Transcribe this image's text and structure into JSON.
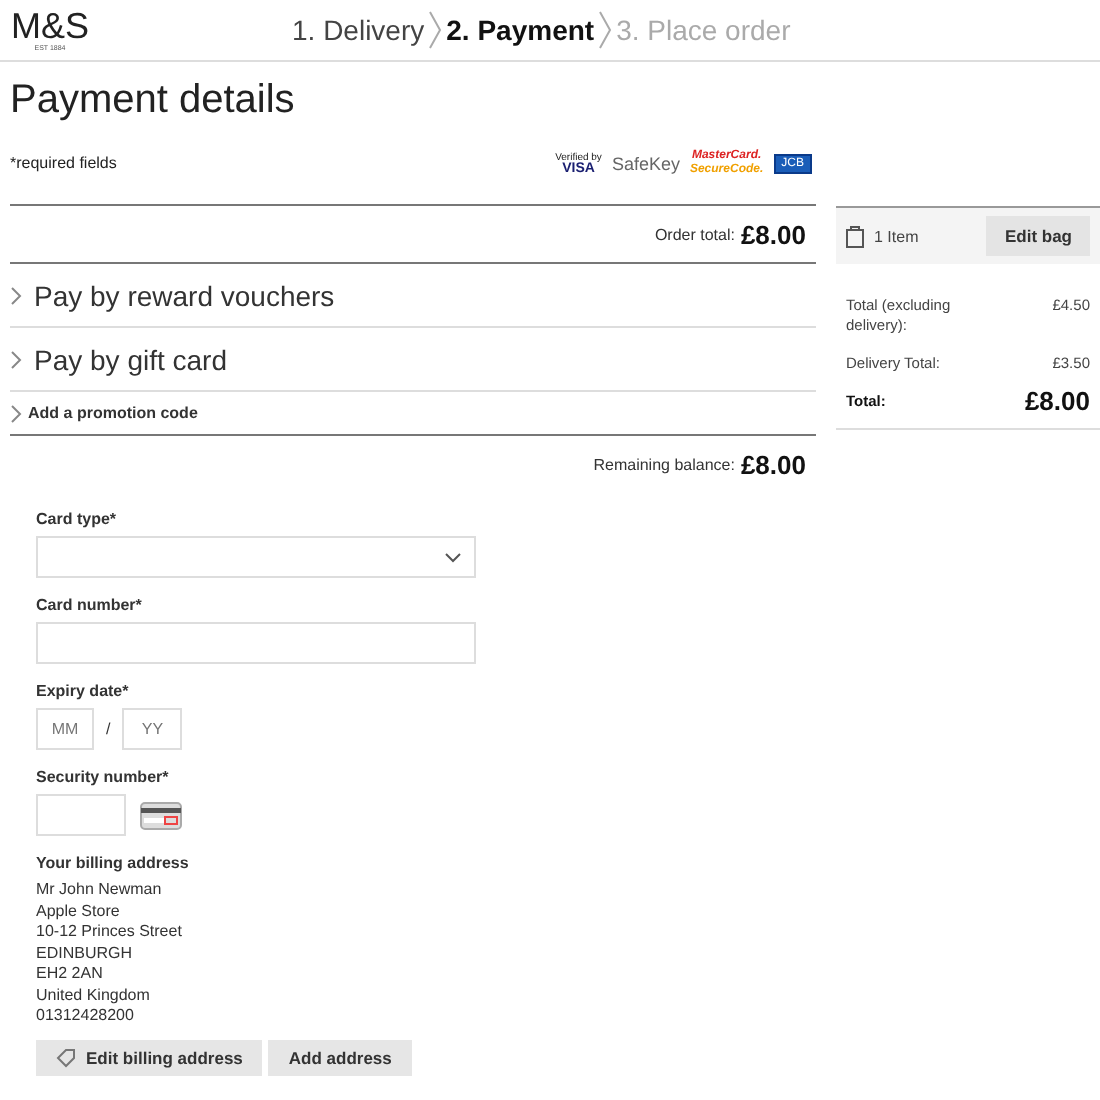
{
  "header": {
    "logo": "M&S",
    "logo_tagline": "EST 1884",
    "steps": [
      {
        "label": "1. Delivery",
        "selected": false
      },
      {
        "label": "2. Payment",
        "selected": true
      },
      {
        "label": "3. Place order",
        "selected": false
      }
    ]
  },
  "title": "Payment details",
  "required_note": "*required fields",
  "security_badges": [
    {
      "kind": "visa",
      "lines": [
        "Verified by",
        "VISA"
      ]
    },
    {
      "kind": "amex",
      "lines": [
        "SafeKey"
      ]
    },
    {
      "kind": "mastercard",
      "lines": [
        "MasterCard.",
        "SecureCode."
      ]
    },
    {
      "kind": "jcb",
      "lines": [
        "JCB"
      ]
    }
  ],
  "order_total": {
    "label": "Order total:",
    "value": "£8.00"
  },
  "sections": [
    {
      "kind": "large",
      "label": "Pay by reward vouchers",
      "expanded": false
    },
    {
      "kind": "large",
      "label": "Pay by gift card",
      "expanded": false
    },
    {
      "kind": "small",
      "label": "Add a promotion code",
      "expanded": false
    }
  ],
  "remaining_balance": {
    "label": "Remaining balance:",
    "value": "£8.00"
  },
  "form": {
    "card_type": {
      "label": "Card type*"
    },
    "card_number": {
      "label": "Card number*"
    },
    "expiry": {
      "label": "Expiry date*",
      "month_placeholder": "MM",
      "separator": "/",
      "year_placeholder": "YY"
    },
    "security": {
      "label": "Security number*"
    }
  },
  "billing": {
    "heading": "Your billing address",
    "lines": [
      "Mr John Newman",
      "Apple Store",
      "10-12 Princes Street",
      "EDINBURGH",
      "EH2 2AN",
      "United Kingdom",
      "01312428200"
    ],
    "buttons": [
      {
        "kind": "edit",
        "label": "Edit billing address"
      },
      {
        "kind": "plain",
        "label": "Add address"
      }
    ]
  },
  "bag": {
    "items": "1 Item",
    "edit_button": "Edit bag",
    "rows": [
      {
        "kind": "normal",
        "label": "Total (excluding delivery):",
        "value": "£4.50"
      },
      {
        "kind": "normal",
        "label": "Delivery Total:",
        "value": "£3.50"
      },
      {
        "kind": "total",
        "label": "Total:",
        "value": "£8.00"
      }
    ]
  }
}
